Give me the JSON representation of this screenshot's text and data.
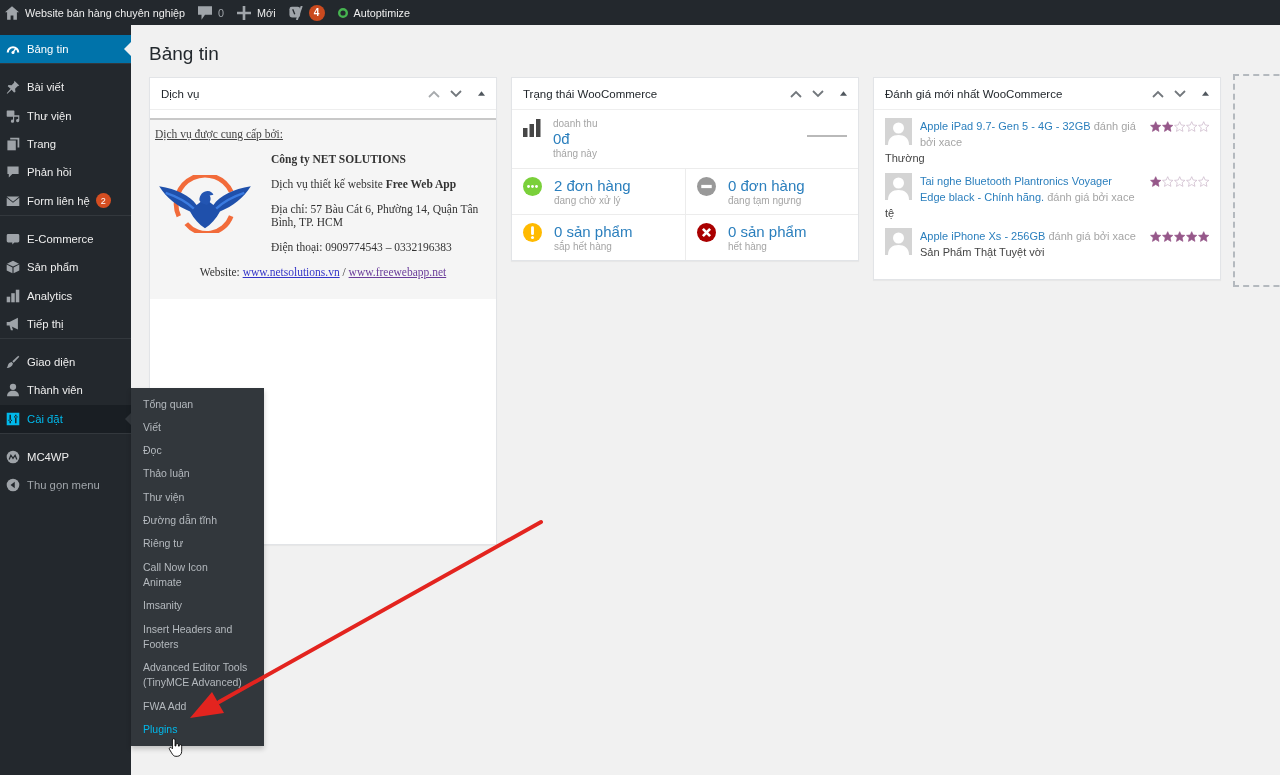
{
  "admin_bar": {
    "site_name": "Website bán hàng chuyên nghiệp",
    "comment_count": "0",
    "new_label": "Mới",
    "seo_badge": "4",
    "autoptimize_label": "Autoptimize"
  },
  "sidebar": {
    "groups": [
      {
        "items": [
          {
            "label": "Bảng tin",
            "selected": true,
            "open": false
          }
        ]
      },
      {
        "items": [
          {
            "label": "Bài viết",
            "selected": false,
            "open": false
          },
          {
            "label": "Thư viện",
            "selected": false,
            "open": false
          },
          {
            "label": "Trang",
            "selected": false,
            "open": false
          },
          {
            "label": "Phản hồi",
            "selected": false,
            "open": false
          },
          {
            "label": "Form liên hệ",
            "selected": false,
            "open": false,
            "badge": "2"
          }
        ]
      },
      {
        "items": [
          {
            "label": "E-Commerce",
            "selected": false,
            "open": false
          },
          {
            "label": "Sản phẩm",
            "selected": false,
            "open": false
          },
          {
            "label": "Analytics",
            "selected": false,
            "open": false
          },
          {
            "label": "Tiếp thị",
            "selected": false,
            "open": false
          }
        ]
      },
      {
        "items": [
          {
            "label": "Giao diện",
            "selected": false,
            "open": false
          },
          {
            "label": "Thành viên",
            "selected": false,
            "open": false
          },
          {
            "label": "Cài đặt",
            "selected": false,
            "open": true
          }
        ]
      },
      {
        "items": [
          {
            "label": "MC4WP",
            "selected": false,
            "open": false
          }
        ]
      }
    ],
    "collapse_label": "Thu gọn menu",
    "flyout": [
      {
        "label": "Tổng quan",
        "selected": false
      },
      {
        "label": "Viết",
        "selected": false
      },
      {
        "label": "Đọc",
        "selected": false
      },
      {
        "label": "Thảo luận",
        "selected": false
      },
      {
        "label": "Thư viện",
        "selected": false
      },
      {
        "label": "Đường dẫn tĩnh",
        "selected": false
      },
      {
        "label": "Riêng tư",
        "selected": false
      },
      {
        "label": "Call Now Icon Animate",
        "selected": false
      },
      {
        "label": "Imsanity",
        "selected": false
      },
      {
        "label": "Insert Headers and Footers",
        "selected": false
      },
      {
        "label": "Advanced Editor Tools (TinyMCE Advanced)",
        "selected": false
      },
      {
        "label": "FWA Add",
        "selected": false
      },
      {
        "label": "Plugins",
        "selected": true
      }
    ]
  },
  "page_title": "Bảng tin",
  "widgets": {
    "services": {
      "title": "Dịch vụ",
      "intro": "Dịch vụ được cung cấp bởi:",
      "company": "Công ty NET SOLUTIONS",
      "tagline": "Dịch vụ thiết kế website **Free Web App**",
      "address": "Địa chỉ: 57 Bàu Cát 6, Phường 14, Quận Tân Bình, TP. HCM",
      "phone": "Điện thoại: 0909774543 – 0332196383",
      "website_label": "Website:",
      "separator": "/",
      "links": [
        {
          "text": "www.netsolutions.vn",
          "visited": false
        },
        {
          "text": "www.freewebapp.net",
          "visited": true
        }
      ]
    },
    "woocommerce_status": {
      "title": "Trạng thái WooCommerce",
      "sales_label": "doanh thu",
      "sales_amount": "0đ",
      "sales_period": "tháng này",
      "stats": [
        {
          "kind": "processing",
          "count": "2 đơn hàng",
          "caption": "đang chờ xử lý"
        },
        {
          "kind": "on_hold",
          "count": "0 đơn hàng",
          "caption": "đang tạm ngưng"
        },
        {
          "kind": "low_stock",
          "count": "0 sản phẩm",
          "caption": "sắp hết hàng"
        },
        {
          "kind": "out_of_stock",
          "count": "0 sản phẩm",
          "caption": "hết hàng"
        }
      ]
    },
    "reviews": {
      "title": "Đánh giá mới nhất WooCommerce",
      "items": [
        {
          "product": "Apple iPad 9.7- Gen 5 - 4G - 32GB",
          "byline": "đánh giá bởi xace",
          "stars": 2,
          "comment": "Thường"
        },
        {
          "product": "Tai nghe Bluetooth Plantronics Voyager Edge black - Chính hãng.",
          "byline": "đánh giá bởi xace",
          "stars": 1,
          "comment": "tệ"
        },
        {
          "product": "Apple iPhone Xs - 256GB",
          "byline": "đánh giá bởi xace",
          "stars": 5,
          "comment": "Sản Phẩm Thật Tuyệt vời"
        }
      ]
    }
  }
}
